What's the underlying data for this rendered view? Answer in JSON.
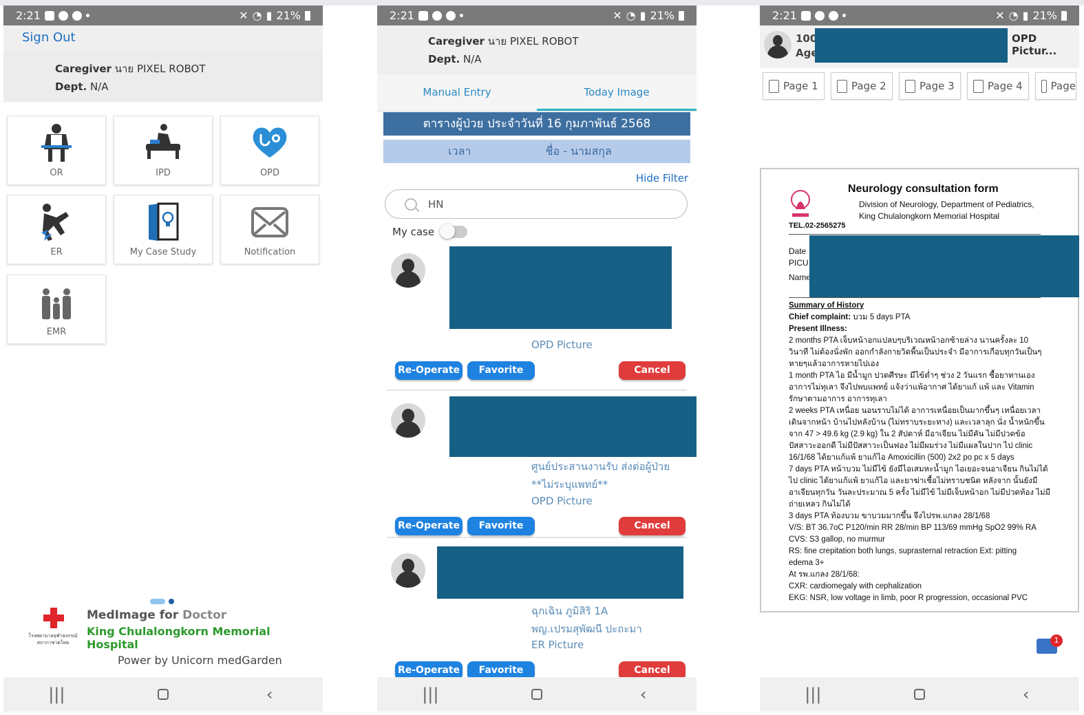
{
  "status": {
    "time": "2:21",
    "battery": "21%"
  },
  "phone1": {
    "sign_out": "Sign Out",
    "caregiver_label": "Caregiver",
    "caregiver_name": "นาย PIXEL ROBOT",
    "dept_label": "Dept.",
    "dept_value": "N/A",
    "tiles": [
      {
        "label": "OR",
        "icon": "surgeon-icon"
      },
      {
        "label": "IPD",
        "icon": "patient-bed-icon"
      },
      {
        "label": "OPD",
        "icon": "heart-stethoscope-icon"
      },
      {
        "label": "ER",
        "icon": "emergency-fall-icon"
      },
      {
        "label": "My Case Study",
        "icon": "door-bulb-icon"
      },
      {
        "label": "Notification",
        "icon": "envelope-icon"
      },
      {
        "label": "EMR",
        "icon": "family-icon"
      }
    ],
    "footer": {
      "app_name": "MedImage for",
      "role": "Doctor",
      "hospital": "King Chulalongkorn Memorial Hospital",
      "power": "Power by Unicorn medGarden",
      "logo_text": "โรงพยาบาลจุฬาลงกรณ์ สภากาชาดไทย"
    }
  },
  "phone2": {
    "caregiver_label": "Caregiver",
    "caregiver_name": "นาย PIXEL ROBOT",
    "dept_label": "Dept.",
    "dept_value": "N/A",
    "tabs": [
      "Manual Entry",
      "Today Image"
    ],
    "banner": "ตารางผู้ป่วย ประจำวันที่ 16 กุมภาพันธ์ 2568",
    "columns": [
      "เวลา",
      "ชื่อ - นามสกุล"
    ],
    "hide_filter": "Hide Filter",
    "search_placeholder": "HN",
    "my_case": "My case",
    "cards": [
      {
        "lines": [
          "OPD Picture"
        ]
      },
      {
        "lines": [
          "ศูนย์ประสานงานรับ ส่งต่อผู้ป่วย",
          "**ไม่ระบุแพทย์**",
          "OPD Picture"
        ]
      },
      {
        "lines": [
          "ฉุกเฉิน ภูมิสิริ 1A",
          "พญ.เปรมสุพัฒนี ปะถะมา",
          "ER Picture"
        ]
      }
    ],
    "buttons": {
      "reoperate": "Re-Operate",
      "favorite": "Favorite",
      "cancel": "Cancel"
    }
  },
  "phone3": {
    "hn_prefix": "100",
    "age_label": "Age",
    "title": "OPD Pictur...",
    "pages": [
      "Page 1",
      "Page 2",
      "Page 3",
      "Page 4",
      "Page"
    ],
    "doc": {
      "title": "Neurology consultation form",
      "sub1": "Division of Neurology, Department of Pediatrics,",
      "sub2": "King Chulalongkorn Memorial Hospital",
      "tel": "TEL.02-2565275",
      "date_label": "Date",
      "picu_label": "PICU",
      "name_label": "Name",
      "summary": "Summary of History",
      "chief_label": "Chief complaint:",
      "chief": "บวม 5 days PTA",
      "present_label": "Present Illness:",
      "lines": [
        "2 months PTA เจ็บหน้าอกแปลบๆบริเวณหน้าอกซ้ายล่าง นานครั้งละ 10",
        "วินาที ไม่ต้องนั่งพัก ออกกำลังกายวิดพื้นเป็นประจำ มีอาการเกือบทุกวันเป็นๆ",
        "หายๆแล้วอาการหายไปเอง",
        "1 month PTA ไอ มีน้ำมูก ปวดศีรษะ มีไข้ต่ำๆ ช่วง 2 วันแรก ซื้อยาทานเอง",
        "อาการไม่ทุเลา จึงไปพบแพทย์ แจ้งว่าแพ้อากาศ ได้ยาแก้ แพ้ และ Vitamin",
        "รักษาตามอาการ อาการทุเลา",
        "2 weeks PTA เหนื่อย นอนราบไม่ได้ อาการเหนื่อยเป็นมากขึ้นๆ เหนื่อยเวลา",
        "เดินจากหน้า บ้านไปหลังบ้าน (ไม่ทราบระยะทาง) และเวลาลุก นั่ง น้ำหนักขึ้น",
        "จาก 47 > 49.6 kg (2.9 kg) ใน 2 สัปดาห์ มีอาเจียน ไม่มีคัน ไม่มีปวดข้อ",
        "ปัสสาวะออกดี ไม่มีปัสสาวะเป็นฟอง ไม่มีผมร่วง ไม่มีแผลในปาก ไป clinic",
        "16/1/68 ได้ยาแก้แพ้ ยาแก้ไอ Amoxicillin (500) 2x2 po pc x 5 days",
        "7 days PTA หน้าบวม ไม่มีไข้ ยังมีไอเสมหะน้ำมูก ไอเยอะจนอาเจียน กินไม่ได้",
        "ไป clinic ได้ยาแก้แพ้ ยาแก้ไอ และยาฆ่าเชื้อไม่ทราบชนิด หลังจาก นั้นยังมี",
        "อาเจียนทุกวัน วันละประมาณ 5 ครั้ง ไม่มีไข้ ไม่มีเจ็บหน้าอก ไม่มีปวดท้อง ไม่มี",
        "ถ่ายเหลว กินไม่ได้",
        "3 days PTA ท้องบวม ขาบวมมากขึ้น จึงไปรพ.แกลง 28/1/68",
        "V/S: BT 36.7oC P120/min RR 28/min BP 113/69 mmHg SpO2 99% RA",
        "CVS: S3 gallop, no murmur",
        "RS: fine crepitation both lungs, suprasternal retraction Ext: pitting",
        "edema 3+",
        " At รพ.แกลง 28/1/68:",
        "CXR: cardiomegaly with cephalization",
        "EKG: NSR, low voltage in limb, poor R progression, occasional PVC"
      ]
    },
    "chat_badge": "1"
  }
}
